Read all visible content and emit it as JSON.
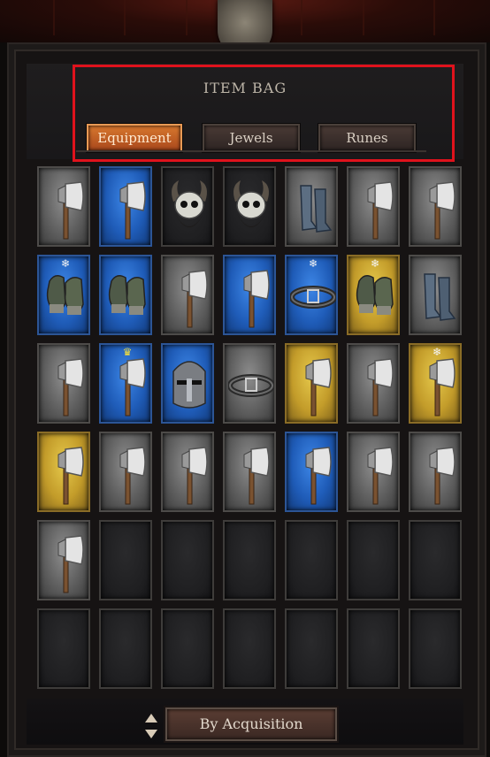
{
  "header": {
    "title": "ITEM BAG"
  },
  "tabs": [
    {
      "label": "Equipment",
      "active": true
    },
    {
      "label": "Jewels",
      "active": false
    },
    {
      "label": "Runes",
      "active": false
    }
  ],
  "grid": {
    "columns": 7,
    "rows": 6,
    "slots": [
      {
        "rarity": "gray",
        "item": "axe-icon"
      },
      {
        "rarity": "blue",
        "item": "axe-icon"
      },
      {
        "rarity": "dark",
        "item": "horned-helm-icon"
      },
      {
        "rarity": "dark",
        "item": "horned-helm-icon"
      },
      {
        "rarity": "gray",
        "item": "boots-icon"
      },
      {
        "rarity": "gray",
        "item": "axe-icon"
      },
      {
        "rarity": "gray",
        "item": "axe-icon"
      },
      {
        "rarity": "blue",
        "item": "gauntlets-icon",
        "badge": "snowflake-icon"
      },
      {
        "rarity": "blue",
        "item": "gauntlets-icon"
      },
      {
        "rarity": "gray",
        "item": "axe-icon"
      },
      {
        "rarity": "blue",
        "item": "axe-icon"
      },
      {
        "rarity": "blue",
        "item": "belt-icon",
        "badge": "snowflake-icon"
      },
      {
        "rarity": "gold",
        "item": "gauntlets-icon",
        "badge": "snowflake-icon"
      },
      {
        "rarity": "gray",
        "item": "boots-icon"
      },
      {
        "rarity": "gray",
        "item": "axe-icon"
      },
      {
        "rarity": "blue",
        "item": "axe-icon",
        "badge": "crown-icon"
      },
      {
        "rarity": "blue",
        "item": "knight-helm-icon"
      },
      {
        "rarity": "gray",
        "item": "belt-icon"
      },
      {
        "rarity": "gold",
        "item": "axe-icon"
      },
      {
        "rarity": "gray",
        "item": "axe-icon"
      },
      {
        "rarity": "gold",
        "item": "axe-icon",
        "badge": "snowflake-icon"
      },
      {
        "rarity": "gold",
        "item": "axe-icon"
      },
      {
        "rarity": "gray",
        "item": "axe-icon"
      },
      {
        "rarity": "gray",
        "item": "axe-icon"
      },
      {
        "rarity": "gray",
        "item": "axe-icon"
      },
      {
        "rarity": "blue",
        "item": "axe-icon"
      },
      {
        "rarity": "gray",
        "item": "axe-icon"
      },
      {
        "rarity": "gray",
        "item": "axe-icon"
      },
      {
        "rarity": "gray",
        "item": "axe-icon"
      },
      {
        "rarity": "empty"
      },
      {
        "rarity": "empty"
      },
      {
        "rarity": "empty"
      },
      {
        "rarity": "empty"
      },
      {
        "rarity": "empty"
      },
      {
        "rarity": "empty"
      },
      {
        "rarity": "empty"
      },
      {
        "rarity": "empty"
      },
      {
        "rarity": "empty"
      },
      {
        "rarity": "empty"
      },
      {
        "rarity": "empty"
      },
      {
        "rarity": "empty"
      },
      {
        "rarity": "empty"
      }
    ]
  },
  "footer": {
    "sort_label": "By Acquisition",
    "sort_icon": "sort-arrows-icon"
  },
  "colors": {
    "active_tab": "#c7652a",
    "highlight_box": "#e0121c",
    "rarity_gray": "#6f6f6f",
    "rarity_blue": "#2a6fd0",
    "rarity_gold": "#d2ae35"
  }
}
